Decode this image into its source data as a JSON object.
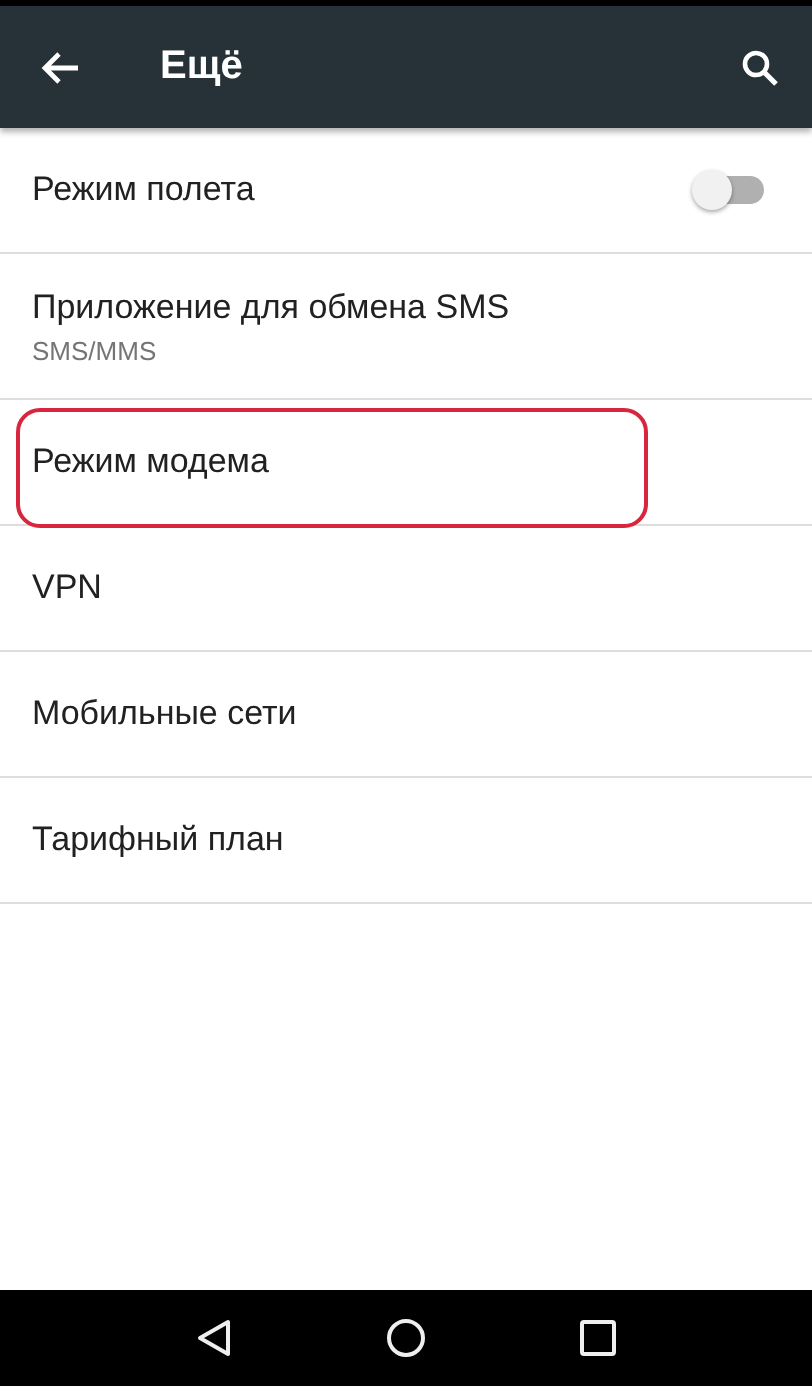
{
  "toolbar": {
    "title": "Ещё"
  },
  "items": [
    {
      "kind": "switch",
      "title": "Режим полета",
      "on": false,
      "highlighted": false
    },
    {
      "kind": "text",
      "title": "Приложение для обмена SMS",
      "subtitle": "SMS/MMS",
      "highlighted": false
    },
    {
      "kind": "text",
      "title": "Режим модема",
      "highlighted": true
    },
    {
      "kind": "text",
      "title": "VPN",
      "highlighted": false
    },
    {
      "kind": "text",
      "title": "Мобильные сети",
      "highlighted": false
    },
    {
      "kind": "text",
      "title": "Тарифный план",
      "highlighted": false
    }
  ]
}
